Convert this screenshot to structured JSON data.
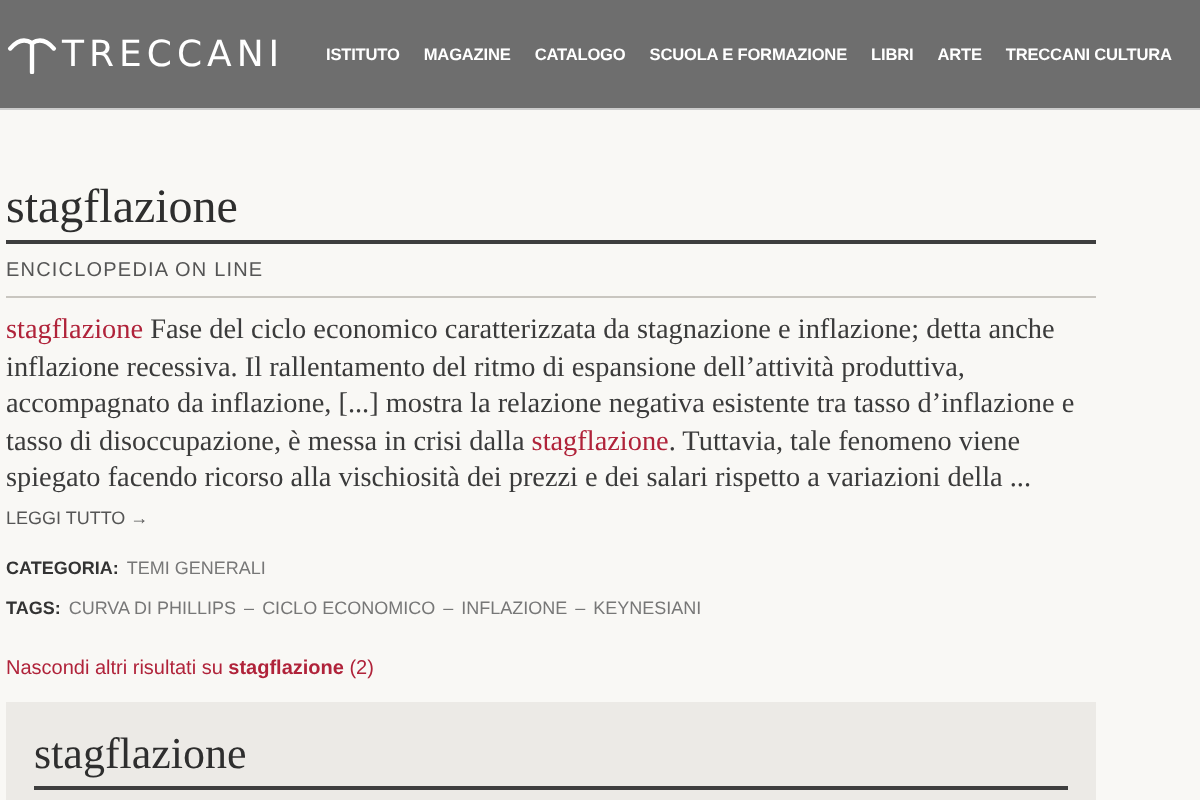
{
  "header": {
    "logo": "TRECCANI",
    "nav": [
      "ISTITUTO",
      "MAGAZINE",
      "CATALOGO",
      "SCUOLA E FORMAZIONE",
      "LIBRI",
      "ARTE",
      "TRECCANI CULTURA"
    ]
  },
  "result": {
    "title": "stagflazione",
    "source": "ENCICLOPEDIA ON LINE",
    "text": "**stagflazione** Fase del ciclo economico caratterizzata da stagnazione e inflazione; detta anche inflazione recessiva. Il rallentamento del ritmo di espansione dell’attività produttiva, accompagnato da inflazione, [...] mostra la relazione negativa esistente tra tasso d’inflazione e tasso di disoccupazione, è messa in crisi dalla **stagflazione**. Tuttavia, tale fenomeno viene spiegato facendo ricorso alla vischiosità dei prezzi e dei salari rispetto a variazioni della ...",
    "read_more": "LEGGI TUTTO →",
    "category_label": "CATEGORIA:",
    "category": "TEMI GENERALI",
    "tags_label": "TAGS:",
    "tag_separator": "–",
    "tags": [
      "CURVA DI PHILLIPS",
      "CICLO ECONOMICO",
      "INFLAZIONE",
      "KEYNESIANI"
    ]
  },
  "toggle": "Nascondi altri risultati su **stagflazione** (2)",
  "next_result": {
    "title": "stagflazione"
  }
}
